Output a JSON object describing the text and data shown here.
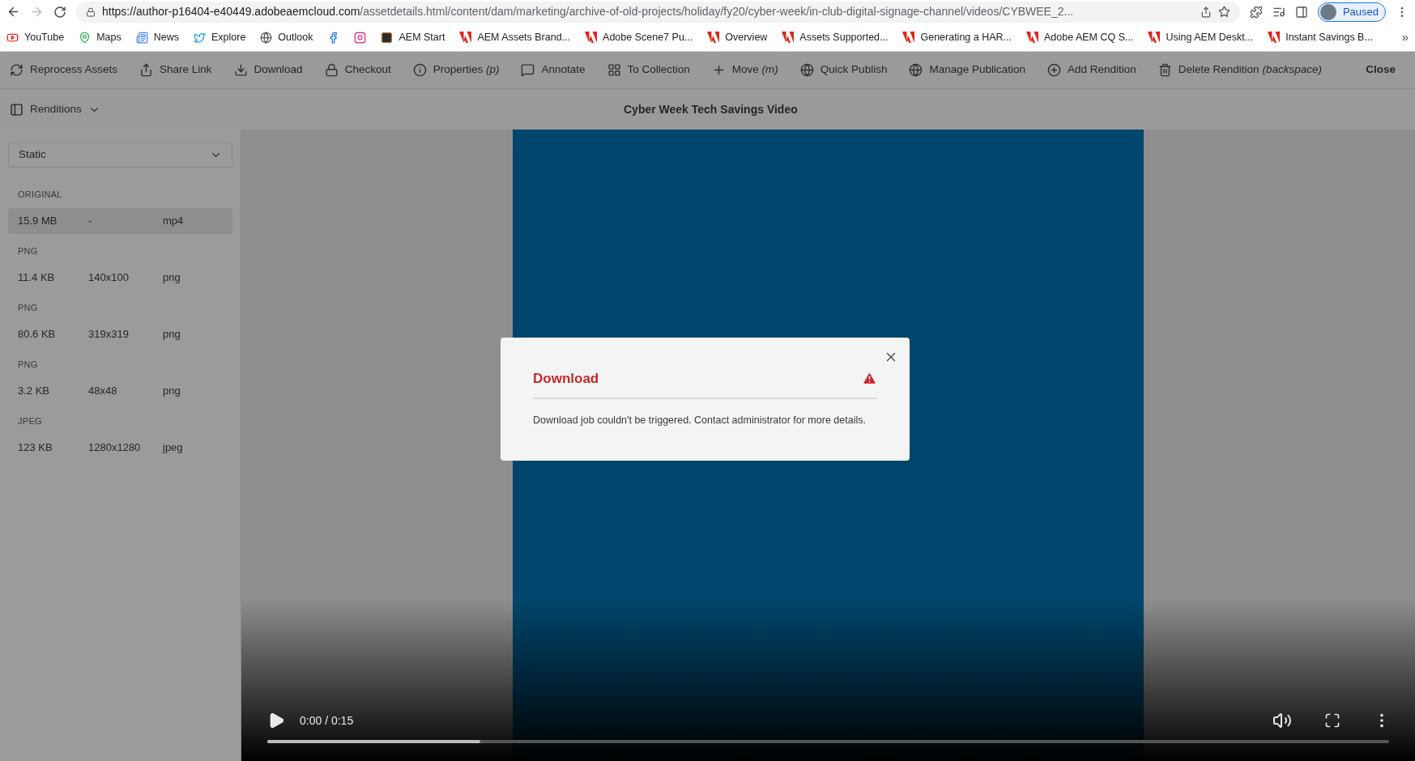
{
  "browser": {
    "url_host": "https://author-p16404-e40449.adobeaemcloud.com",
    "url_path": "/assetdetails.html/content/dam/marketing/archive-of-old-projects/holiday/fy20/cyber-week/in-club-digital-signage-channel/videos/CYBWEE_2...",
    "profile_label": "Paused",
    "bookmarks": [
      {
        "kind": "link",
        "label": "YouTube"
      },
      {
        "kind": "link",
        "label": "Maps"
      },
      {
        "kind": "link",
        "label": "News"
      },
      {
        "kind": "link",
        "label": "Explore"
      },
      {
        "kind": "link",
        "label": "Outlook"
      },
      {
        "kind": "icon-only"
      },
      {
        "kind": "icon-only"
      },
      {
        "kind": "link",
        "label": "AEM Start"
      },
      {
        "kind": "link",
        "label": "AEM Assets Brand..."
      },
      {
        "kind": "link",
        "label": "Adobe Scene7 Pu..."
      },
      {
        "kind": "link",
        "label": "Overview"
      },
      {
        "kind": "link",
        "label": "Assets Supported..."
      },
      {
        "kind": "link",
        "label": "Generating a HAR..."
      },
      {
        "kind": "link",
        "label": "Adobe AEM CQ S..."
      },
      {
        "kind": "link",
        "label": "Using AEM Deskt..."
      },
      {
        "kind": "link",
        "label": "Instant Savings B..."
      }
    ],
    "more_bookmarks": "»"
  },
  "toolbar": {
    "actions": [
      {
        "label": "Reprocess Assets"
      },
      {
        "label": "Share Link"
      },
      {
        "label": "Download"
      },
      {
        "label": "Checkout"
      },
      {
        "label": "Properties",
        "shortcut": "(p)"
      },
      {
        "label": "Annotate"
      },
      {
        "label": "To Collection"
      },
      {
        "label": "Move",
        "shortcut": "(m)"
      },
      {
        "label": "Quick Publish"
      },
      {
        "label": "Manage Publication"
      },
      {
        "label": "Add Rendition"
      },
      {
        "label": "Delete Rendition",
        "shortcut": "(backspace)"
      }
    ],
    "close": "Close"
  },
  "header": {
    "panel_toggle": "Renditions",
    "title": "Cyber Week Tech Savings Video"
  },
  "sidebar": {
    "select_value": "Static",
    "groups": [
      {
        "heading": "ORIGINAL",
        "size": "15.9 MB",
        "dimensions": "-",
        "format": "mp4",
        "selected": true
      },
      {
        "heading": "PNG",
        "size": "11.4 KB",
        "dimensions": "140x100",
        "format": "png",
        "selected": false
      },
      {
        "heading": "PNG",
        "size": "80.6 KB",
        "dimensions": "319x319",
        "format": "png",
        "selected": false
      },
      {
        "heading": "PNG",
        "size": "3.2 KB",
        "dimensions": "48x48",
        "format": "png",
        "selected": false
      },
      {
        "heading": "JPEG",
        "size": "123 KB",
        "dimensions": "1280x1280",
        "format": "jpeg",
        "selected": false
      }
    ]
  },
  "player": {
    "time": "0:00 / 0:15",
    "progress": {
      "level": 0.19
    }
  },
  "dialog": {
    "title": "Download",
    "message": "Download job couldn't be triggered. Contact administrator for more details."
  }
}
